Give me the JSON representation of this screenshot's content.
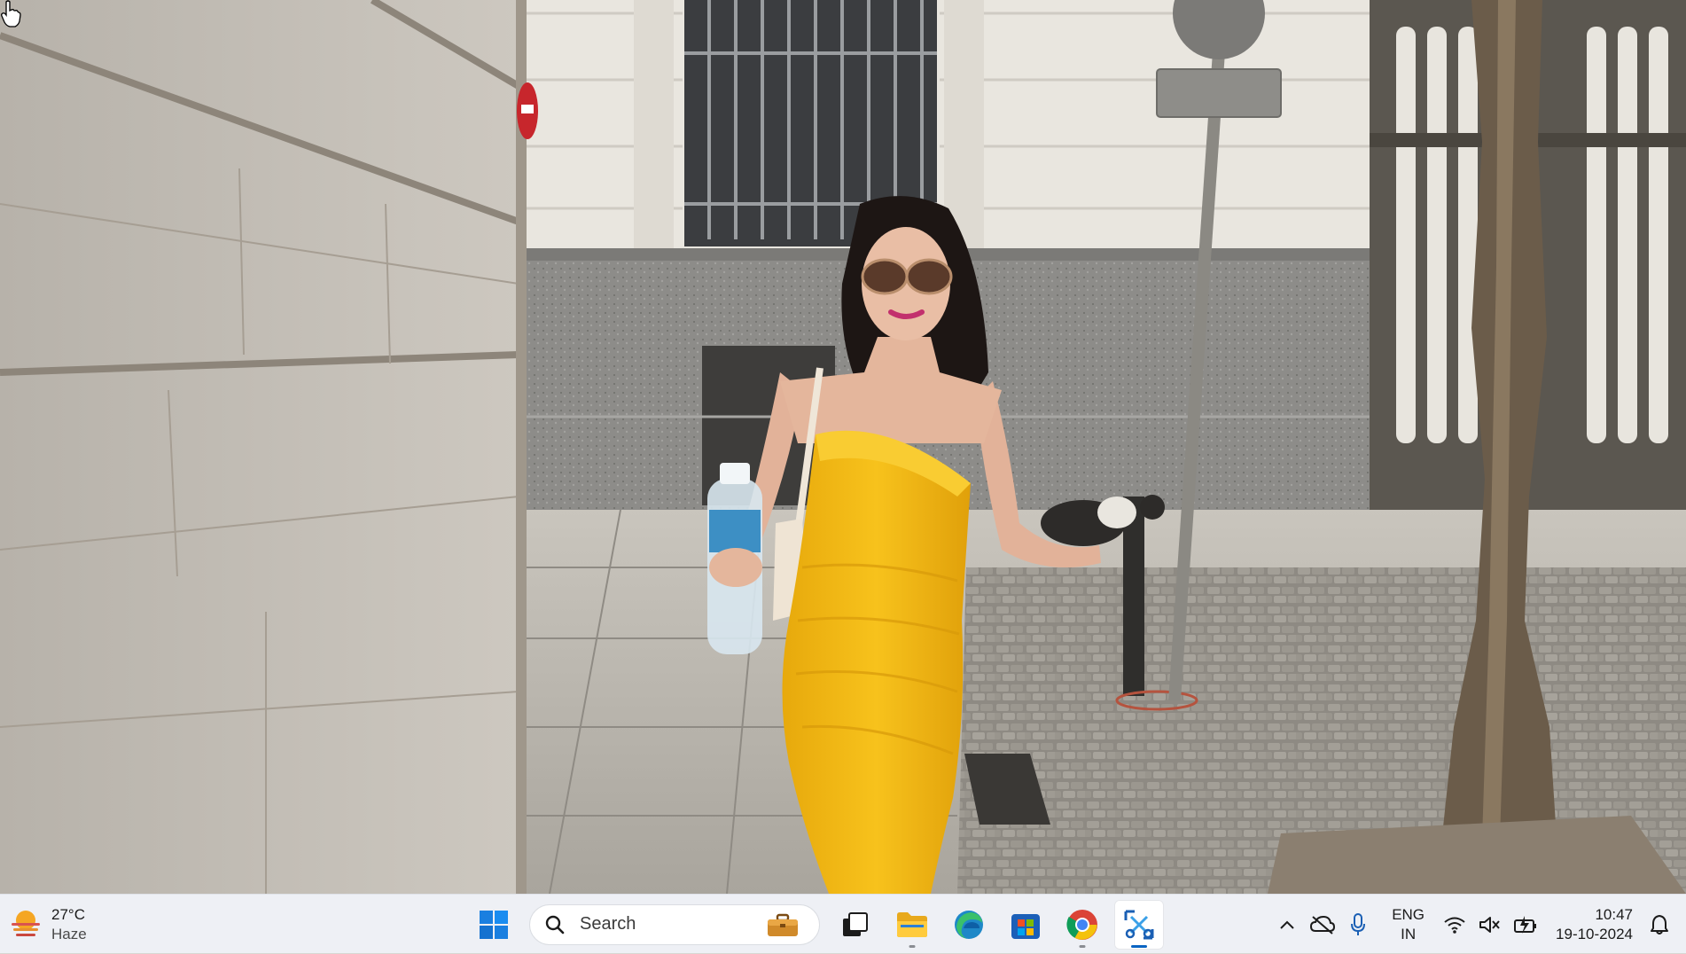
{
  "cursor": {
    "icon": "hand-pointer-icon"
  },
  "weather": {
    "temperature": "27°C",
    "condition": "Haze",
    "icon": "haze-sun-icon"
  },
  "taskbar": {
    "start_icon": "windows-start-icon",
    "search": {
      "label": "Search",
      "icon": "search-icon",
      "badge_icon": "briefcase-icon"
    },
    "apps": [
      {
        "name": "task-view",
        "icon": "task-view-icon",
        "running": false,
        "active": false
      },
      {
        "name": "file-explorer",
        "icon": "folder-icon",
        "running": true,
        "active": false
      },
      {
        "name": "edge",
        "icon": "edge-icon",
        "running": false,
        "active": false
      },
      {
        "name": "microsoft-store",
        "icon": "store-icon",
        "running": false,
        "active": false
      },
      {
        "name": "chrome",
        "icon": "chrome-icon",
        "running": true,
        "active": false
      },
      {
        "name": "snipping-tool",
        "icon": "snipping-tool-icon",
        "running": true,
        "active": true
      }
    ]
  },
  "tray": {
    "overflow_icon": "chevron-up-icon",
    "onedrive_icon": "cloud-offline-icon",
    "mic_icon": "microphone-icon",
    "language": {
      "line1": "ENG",
      "line2": "IN"
    },
    "wifi_icon": "wifi-icon",
    "volume_icon": "volume-muted-icon",
    "battery_icon": "battery-charging-icon",
    "time": "10:47",
    "date": "19-10-2024",
    "notification_icon": "bell-icon"
  },
  "colors": {
    "taskbar_bg": "#eef0f5",
    "accent": "#0a64c2",
    "dress": "#f2b814"
  }
}
